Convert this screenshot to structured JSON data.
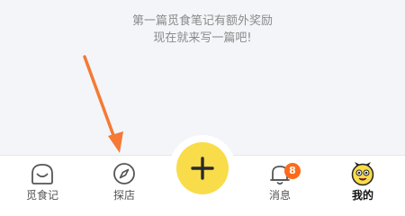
{
  "promo": {
    "line1": "第一篇觅食笔记有额外奖励",
    "line2": "现在就来写一篇吧!"
  },
  "tabbar": {
    "items": [
      {
        "label": "觅食记",
        "icon": "smile-face-icon",
        "active": false
      },
      {
        "label": "探店",
        "icon": "compass-icon",
        "active": false
      },
      {
        "label": "消息",
        "icon": "bell-icon",
        "active": false,
        "badge": "8"
      },
      {
        "label": "我的",
        "icon": "yellow-mascot-icon",
        "active": true
      }
    ],
    "center_button": {
      "icon": "plus-icon"
    }
  },
  "annotation": {
    "icon": "orange-arrow",
    "color": "#f47a35"
  },
  "colors": {
    "accent_yellow": "#f8dc4a",
    "badge_orange": "#ff6a1a",
    "content_bg": "#f4f5f9"
  }
}
